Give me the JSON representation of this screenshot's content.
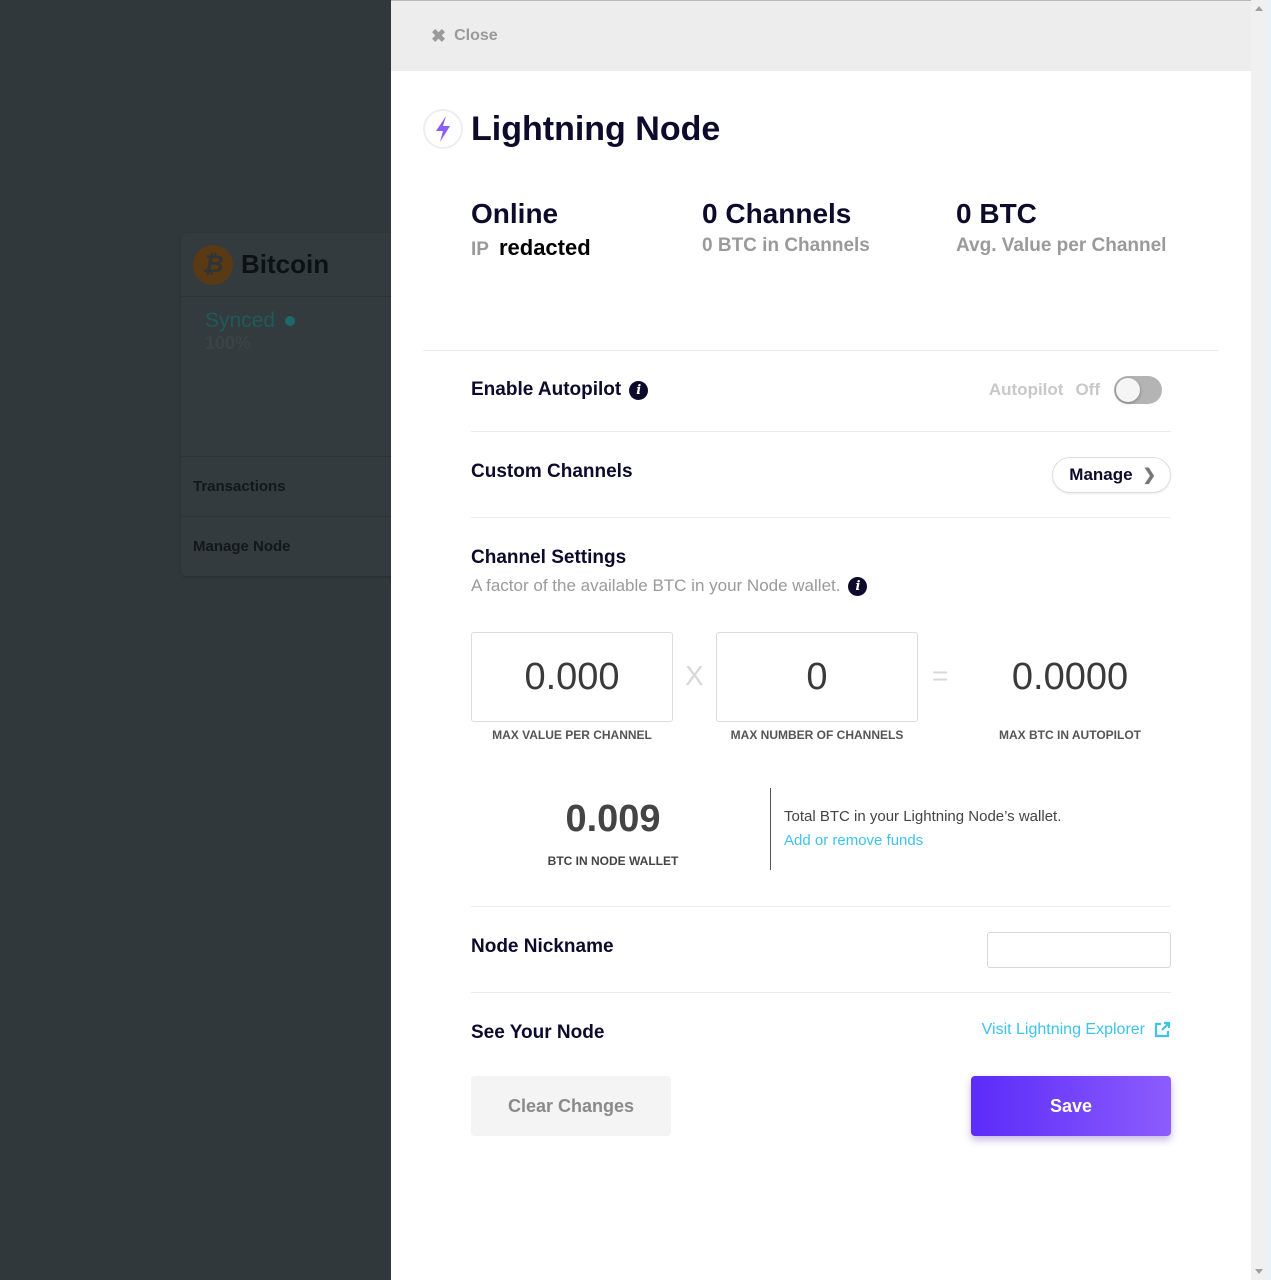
{
  "background": {
    "card_title": "Bitcoin",
    "card_icon": "bitcoin-icon",
    "sync_status": "Synced",
    "sync_percent": "100%",
    "nav_items": [
      {
        "label": "Transactions"
      },
      {
        "label": "Manage Node"
      }
    ]
  },
  "drawer": {
    "close_label": "Close",
    "close_icon": "close-icon",
    "title": "Lightning Node",
    "title_icon": "lightning-bolt-icon",
    "stats": {
      "status": "Online",
      "ip_label": "IP",
      "ip_value": "redacted",
      "channels": "0 Channels",
      "channels_sub": "0 BTC in Channels",
      "avg_value": "0 BTC",
      "avg_value_sub": "Avg. Value per Channel"
    },
    "autopilot": {
      "label": "Enable Autopilot",
      "state_label": "Autopilot",
      "state_value": "Off",
      "enabled": false
    },
    "custom_channels": {
      "label": "Custom Channels",
      "button_label": "Manage",
      "button_icon": "chevron-right-icon"
    },
    "channel_settings": {
      "heading": "Channel Settings",
      "subtext": "A factor of the available BTC in your Node wallet.",
      "max_value_per_channel": "0.000",
      "max_value_per_channel_label": "MAX VALUE PER CHANNEL",
      "multiply_sign": "X",
      "max_number_of_channels": "0",
      "max_number_of_channels_label": "MAX NUMBER OF CHANNELS",
      "equals_sign": "=",
      "max_btc_in_autopilot": "0.0000",
      "max_btc_in_autopilot_label": "MAX BTC IN AUTOPILOT"
    },
    "wallet": {
      "value": "0.009",
      "label": "BTC IN NODE WALLET",
      "description": "Total BTC in your Lightning Node’s wallet.",
      "link": "Add or remove funds"
    },
    "nickname": {
      "label": "Node Nickname",
      "value": "",
      "placeholder": ""
    },
    "see_node": {
      "label": "See Your Node",
      "link": "Visit Lightning Explorer",
      "link_icon": "external-link-icon"
    },
    "buttons": {
      "clear": "Clear Changes",
      "save": "Save"
    },
    "colors": {
      "accent": "#5b2bf9",
      "accent_end": "#8c5cfd",
      "link": "#3dc3ee",
      "heading": "#0d0a2b"
    }
  }
}
